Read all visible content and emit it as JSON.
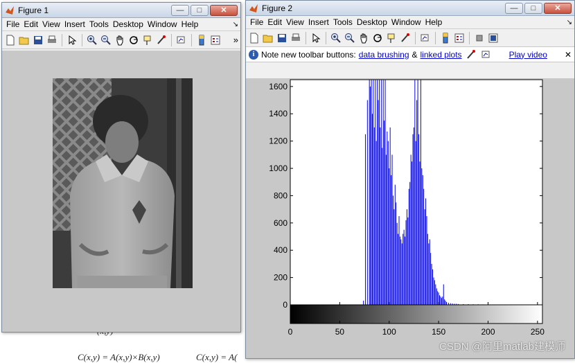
{
  "background_text": {
    "line1": "(x,y)",
    "line2": "C(x,y) = A(x,y)×B(x,y)",
    "line3": "C(x,y) = A("
  },
  "figure1": {
    "title": "Figure 1",
    "menu": [
      "File",
      "Edit",
      "View",
      "Insert",
      "Tools",
      "Desktop",
      "Window",
      "Help"
    ],
    "dock_glyph": "↘",
    "overflow_glyph": "»",
    "buttons": {
      "minimize": "—",
      "maximize": "□",
      "close": "✕"
    }
  },
  "figure2": {
    "title": "Figure 2",
    "menu": [
      "File",
      "Edit",
      "View",
      "Insert",
      "Tools",
      "Desktop",
      "Window",
      "Help"
    ],
    "dock_glyph": "↘",
    "buttons": {
      "minimize": "—",
      "maximize": "□",
      "close": "✕"
    },
    "info": {
      "prefix": "Note new toolbar buttons:",
      "link1": "data brushing",
      "amp": "&",
      "link2": "linked plots",
      "video": "Play video",
      "close": "✕"
    }
  },
  "watermark": "CSDN @阿里matlab建模师",
  "colors": {
    "bar": "#0000ee",
    "accent": "#2a5db0"
  },
  "chart_data": {
    "type": "bar",
    "title": "",
    "xlabel": "",
    "ylabel": "",
    "xlim": [
      0,
      255
    ],
    "ylim": [
      0,
      1650
    ],
    "yticks": [
      0,
      200,
      400,
      600,
      800,
      1000,
      1200,
      1400,
      1600
    ],
    "xticks": [
      0,
      50,
      100,
      150,
      200,
      250
    ],
    "grid": false,
    "colorbar": "grayscale 0-255 below x axis",
    "series": [
      {
        "x": [
          74,
          76,
          78,
          80,
          81,
          82,
          83,
          84,
          85,
          86,
          87,
          88,
          89,
          90,
          91,
          92,
          93,
          94,
          95,
          96,
          97,
          98,
          99,
          100,
          101,
          102,
          103,
          104,
          105,
          106,
          107,
          108,
          109,
          110,
          111,
          112,
          113,
          114,
          115,
          116,
          117,
          118,
          119,
          120,
          121,
          122,
          123,
          124,
          125,
          126,
          127,
          128,
          129,
          130,
          131,
          132,
          133,
          134,
          135,
          136,
          137,
          138,
          139,
          140,
          141,
          142,
          143,
          144,
          145,
          146,
          147,
          148,
          149,
          150,
          151,
          152,
          153,
          154,
          155,
          156,
          157,
          158,
          160,
          162,
          164,
          166,
          168,
          170,
          175,
          180,
          185,
          190,
          195,
          200,
          205,
          210,
          215,
          220
        ],
        "values": [
          30,
          1250,
          1500,
          1650,
          1600,
          1650,
          1400,
          1650,
          1300,
          1650,
          1200,
          1650,
          1500,
          1650,
          1300,
          1650,
          1150,
          1650,
          1350,
          1650,
          1100,
          1270,
          1200,
          1000,
          1300,
          950,
          1100,
          800,
          700,
          880,
          750,
          600,
          520,
          650,
          500,
          480,
          450,
          520,
          550,
          500,
          620,
          700,
          640,
          850,
          900,
          1100,
          1050,
          1250,
          1300,
          1650,
          1200,
          1500,
          1650,
          1250,
          1050,
          1650,
          1000,
          950,
          850,
          700,
          780,
          650,
          520,
          450,
          480,
          380,
          300,
          260,
          200,
          180,
          150,
          120,
          100,
          90,
          70,
          60,
          50,
          60,
          150,
          40,
          30,
          20,
          15,
          12,
          10,
          8,
          8,
          6,
          5,
          5,
          4,
          4,
          3,
          3,
          2,
          2,
          2,
          1
        ]
      }
    ]
  }
}
